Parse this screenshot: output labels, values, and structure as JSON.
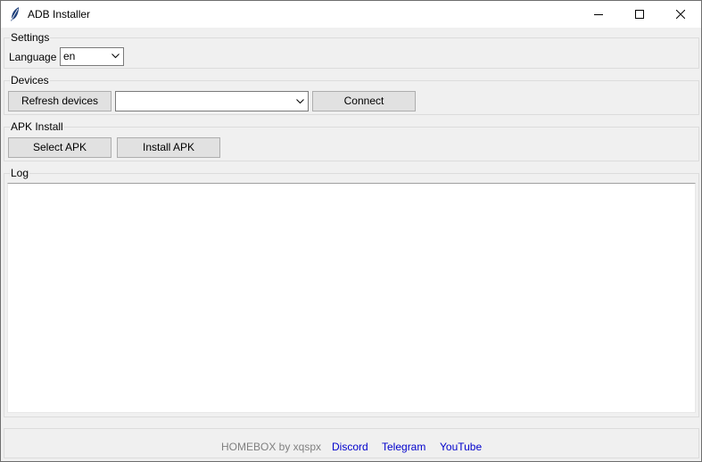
{
  "window": {
    "title": "ADB Installer"
  },
  "settings": {
    "group_label": "Settings",
    "language_label": "Language",
    "language_value": "en"
  },
  "devices": {
    "group_label": "Devices",
    "refresh_label": "Refresh devices",
    "device_value": "",
    "connect_label": "Connect"
  },
  "apk": {
    "group_label": "APK Install",
    "select_label": "Select APK",
    "install_label": "Install APK"
  },
  "log": {
    "group_label": "Log",
    "content": ""
  },
  "footer": {
    "credit": "HOMEBOX by xqspx",
    "links": [
      "Discord",
      "Telegram",
      "YouTube"
    ],
    "link_color": "#0000cc"
  }
}
